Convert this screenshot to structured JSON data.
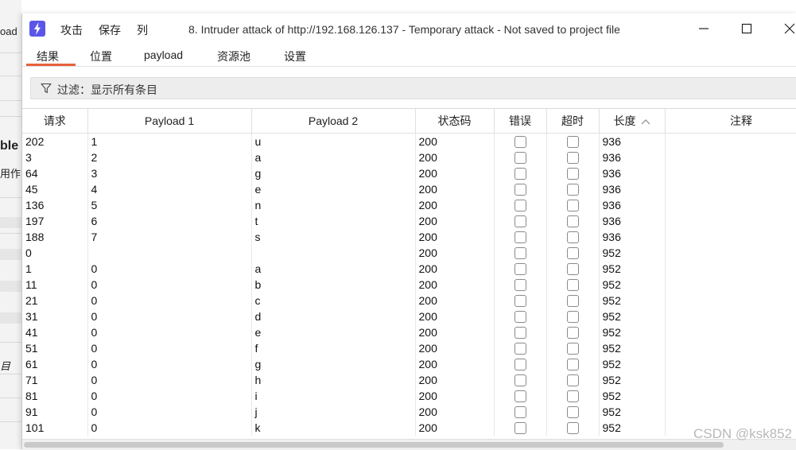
{
  "background_window": {
    "text1": "oad",
    "text2": "ble",
    "text3": "用作",
    "text4": "目"
  },
  "window": {
    "icon": "lightning-icon",
    "menu": [
      "攻击",
      "保存",
      "列"
    ],
    "title": "8. Intruder attack of http://192.168.126.137 - Temporary attack - Not saved to project file"
  },
  "tabs": [
    "结果",
    "位置",
    "payload",
    "资源池",
    "设置"
  ],
  "filter": {
    "icon": "funnel-icon",
    "text": "过滤：显示所有条目"
  },
  "table": {
    "headers": [
      "请求",
      "Payload 1",
      "Payload 2",
      "状态码",
      "错误",
      "超时",
      "长度",
      "注释"
    ],
    "sort_column": "长度",
    "sort_direction": "ascending",
    "rows": [
      [
        "202",
        "1",
        "u",
        "200",
        "936"
      ],
      [
        "3",
        "2",
        "a",
        "200",
        "936"
      ],
      [
        "64",
        "3",
        "g",
        "200",
        "936"
      ],
      [
        "45",
        "4",
        "e",
        "200",
        "936"
      ],
      [
        "136",
        "5",
        "n",
        "200",
        "936"
      ],
      [
        "197",
        "6",
        "t",
        "200",
        "936"
      ],
      [
        "188",
        "7",
        "s",
        "200",
        "936"
      ],
      [
        "0",
        "",
        "",
        "200",
        "952"
      ],
      [
        "1",
        "0",
        "a",
        "200",
        "952"
      ],
      [
        "11",
        "0",
        "b",
        "200",
        "952"
      ],
      [
        "21",
        "0",
        "c",
        "200",
        "952"
      ],
      [
        "31",
        "0",
        "d",
        "200",
        "952"
      ],
      [
        "41",
        "0",
        "e",
        "200",
        "952"
      ],
      [
        "51",
        "0",
        "f",
        "200",
        "952"
      ],
      [
        "61",
        "0",
        "g",
        "200",
        "952"
      ],
      [
        "71",
        "0",
        "h",
        "200",
        "952"
      ],
      [
        "81",
        "0",
        "i",
        "200",
        "952"
      ],
      [
        "91",
        "0",
        "j",
        "200",
        "952"
      ],
      [
        "101",
        "0",
        "k",
        "200",
        "952"
      ]
    ]
  },
  "watermark": "CSDN @ksk852",
  "colors": {
    "accent": "#e8603c",
    "app_icon": "#5b56e8"
  }
}
